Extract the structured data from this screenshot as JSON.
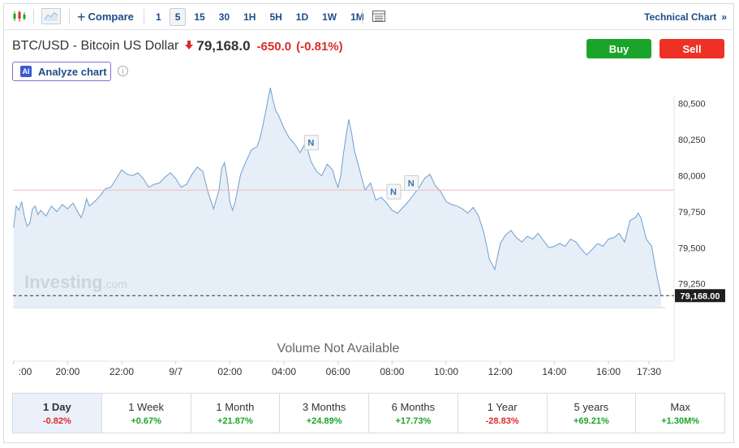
{
  "toolbar": {
    "compare_label": "Compare",
    "intervals": [
      "1",
      "5",
      "15",
      "30",
      "1H",
      "5H",
      "1D",
      "1W",
      "1M"
    ],
    "active_interval": "5",
    "technical_chart_label": "Technical Chart",
    "chevron": "»"
  },
  "header": {
    "title": "BTC/USD - Bitcoin US Dollar",
    "direction_icon": "down-arrow-icon",
    "price": "79,168.0",
    "change": "-650.0",
    "change_pct": "(-0.81%)"
  },
  "buttons": {
    "buy": "Buy",
    "sell": "Sell"
  },
  "analyze": {
    "badge": "AI",
    "label": "Analyze chart",
    "info": "i"
  },
  "colors": {
    "line": "#6e9fd0",
    "area": "#e6eef7",
    "prev_close_line": "#f0b8b8",
    "buy": "#1aa52a",
    "sell": "#ee3124",
    "down": "#dc2b2b",
    "up": "#1aa52a",
    "link": "#1e4b8a"
  },
  "watermark": {
    "brand": "Investing",
    "suffix": ".com"
  },
  "chart_data": {
    "type": "area",
    "y_ticks": [
      "80,500",
      "80,250",
      "80,000",
      "79,750",
      "79,500",
      "79,250"
    ],
    "y_tick_values": [
      80500,
      80250,
      80000,
      79750,
      79500,
      79250
    ],
    "ylim": [
      79085,
      80560
    ],
    "x_ticks": [
      ":00",
      "20:00",
      "22:00",
      "9/7",
      "02:00",
      "04:00",
      "06:00",
      "08:00",
      "10:00",
      "12:00",
      "14:00",
      "16:00",
      "17:30"
    ],
    "x_tick_values": [
      -2,
      0,
      2,
      4,
      6,
      8,
      10,
      12,
      14,
      16,
      18,
      20,
      21.5
    ],
    "xlim": [
      -2.02,
      22.1
    ],
    "previous_close": 79900,
    "last_price_label": "79,168.00",
    "last_price": 79168,
    "grid": false,
    "news_markers": [
      {
        "label": "N",
        "x": 9.0
      },
      {
        "label": "N",
        "x": 12.05
      },
      {
        "label": "N",
        "x": 12.7
      }
    ],
    "series": [
      {
        "x": [
          -2.0,
          -1.9,
          -1.8,
          -1.7,
          -1.6,
          -1.5,
          -1.4,
          -1.3,
          -1.2,
          -1.1,
          -1.0,
          -0.8,
          -0.6,
          -0.4,
          -0.2,
          0.0,
          0.2,
          0.4,
          0.5,
          0.6,
          0.7,
          0.8,
          1.0,
          1.2,
          1.4,
          1.6,
          1.8,
          2.0,
          2.2,
          2.4,
          2.6,
          2.8,
          3.0,
          3.2,
          3.4,
          3.6,
          3.8,
          4.0,
          4.2,
          4.4,
          4.6,
          4.8,
          5.0,
          5.2,
          5.4,
          5.6,
          5.7,
          5.8,
          5.9,
          6.0,
          6.1,
          6.2,
          6.4,
          6.6,
          6.8,
          7.0,
          7.1,
          7.2,
          7.3,
          7.4,
          7.5,
          7.6,
          7.7,
          7.8,
          8.0,
          8.2,
          8.4,
          8.6,
          8.8,
          9.0,
          9.2,
          9.4,
          9.6,
          9.8,
          9.9,
          10.0,
          10.1,
          10.2,
          10.3,
          10.4,
          10.5,
          10.6,
          10.8,
          11.0,
          11.2,
          11.4,
          11.6,
          11.8,
          12.0,
          12.2,
          12.4,
          12.6,
          12.8,
          13.0,
          13.2,
          13.4,
          13.6,
          13.8,
          14.0,
          14.2,
          14.4,
          14.6,
          14.8,
          15.0,
          15.2,
          15.4,
          15.6,
          15.8,
          16.0,
          16.2,
          16.4,
          16.6,
          16.8,
          17.0,
          17.2,
          17.4,
          17.6,
          17.8,
          18.0,
          18.2,
          18.4,
          18.6,
          18.8,
          19.0,
          19.2,
          19.4,
          19.6,
          19.8,
          20.0,
          20.2,
          20.4,
          20.6,
          20.8,
          21.0,
          21.1,
          21.2,
          21.4,
          21.6,
          21.8,
          21.95
        ],
        "y": [
          79640,
          79790,
          79760,
          79820,
          79720,
          79650,
          79670,
          79770,
          79790,
          79730,
          79760,
          79720,
          79790,
          79750,
          79800,
          79770,
          79810,
          79740,
          79710,
          79760,
          79840,
          79790,
          79820,
          79860,
          79910,
          79920,
          79980,
          80040,
          80010,
          80000,
          80020,
          79980,
          79920,
          79940,
          79950,
          79990,
          80020,
          79980,
          79920,
          79940,
          80010,
          80060,
          80030,
          79880,
          79770,
          79900,
          80050,
          80090,
          79990,
          79820,
          79760,
          79820,
          80010,
          80100,
          80180,
          80200,
          80250,
          80330,
          80420,
          80520,
          80610,
          80520,
          80450,
          80420,
          80330,
          80260,
          80220,
          80160,
          80230,
          80100,
          80030,
          80000,
          80080,
          80040,
          79970,
          79920,
          80000,
          80150,
          80280,
          80390,
          80300,
          80180,
          80040,
          79900,
          79950,
          79830,
          79850,
          79810,
          79760,
          79740,
          79780,
          79820,
          79870,
          79920,
          79980,
          80010,
          79930,
          79890,
          79820,
          79800,
          79790,
          79770,
          79740,
          79780,
          79720,
          79600,
          79420,
          79350,
          79530,
          79590,
          79620,
          79570,
          79540,
          79580,
          79560,
          79600,
          79550,
          79500,
          79510,
          79530,
          79510,
          79560,
          79540,
          79490,
          79450,
          79490,
          79530,
          79510,
          79560,
          79570,
          79600,
          79540,
          79690,
          79710,
          79740,
          79710,
          79560,
          79510,
          79300,
          79168
        ]
      }
    ],
    "volume_label": "Volume Not Available"
  },
  "periods": [
    {
      "label": "1 Day",
      "value": "-0.82%",
      "dir": "neg",
      "active": true
    },
    {
      "label": "1 Week",
      "value": "+0.67%",
      "dir": "pos",
      "active": false
    },
    {
      "label": "1 Month",
      "value": "+21.87%",
      "dir": "pos",
      "active": false
    },
    {
      "label": "3 Months",
      "value": "+24.89%",
      "dir": "pos",
      "active": false
    },
    {
      "label": "6 Months",
      "value": "+17.73%",
      "dir": "pos",
      "active": false
    },
    {
      "label": "1 Year",
      "value": "-28.83%",
      "dir": "neg",
      "active": false
    },
    {
      "label": "5 years",
      "value": "+69.21%",
      "dir": "pos",
      "active": false
    },
    {
      "label": "Max",
      "value": "+1.30M%",
      "dir": "pos",
      "active": false
    }
  ]
}
